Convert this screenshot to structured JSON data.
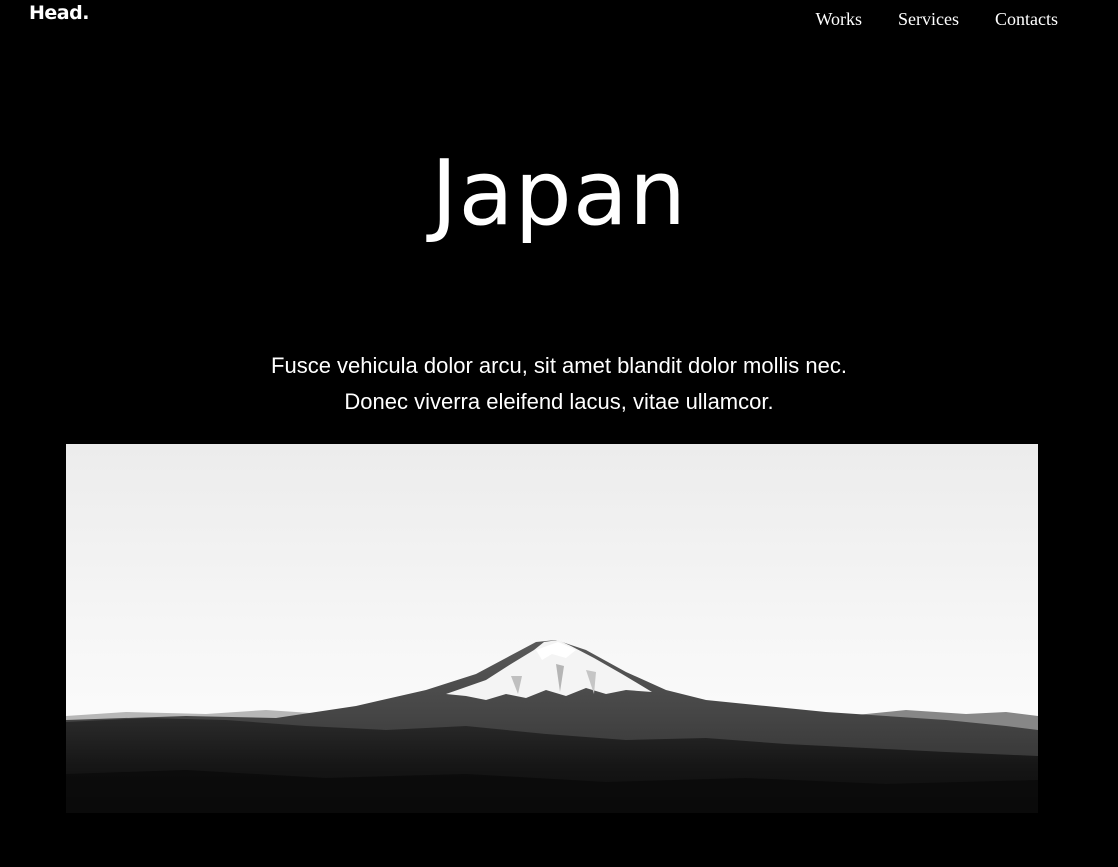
{
  "header": {
    "logo": "Head.",
    "nav": [
      {
        "label": "Works"
      },
      {
        "label": "Services"
      },
      {
        "label": "Contacts"
      }
    ]
  },
  "hero": {
    "title": "Japan",
    "text_line1": "Fusce vehicula dolor arcu, sit amet blandit dolor mollis nec.",
    "text_line2": "Donec viverra eleifend lacus, vitae ullamcor."
  },
  "colors": {
    "background": "#000000",
    "text": "#ffffff"
  }
}
